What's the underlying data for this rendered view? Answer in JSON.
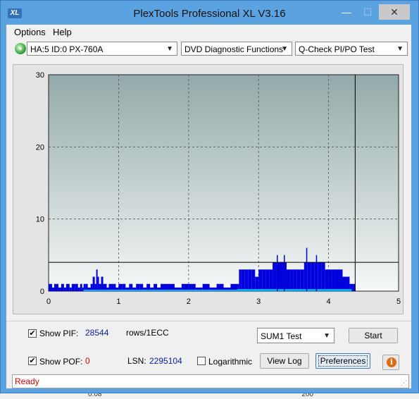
{
  "window": {
    "title": "PlexTools Professional XL V3.16",
    "app_icon_text": "XL",
    "minimize_glyph": "—",
    "maximize_glyph": "☐",
    "close_glyph": "✕"
  },
  "menu": {
    "options_label": "Options",
    "help_label": "Help"
  },
  "toolbar": {
    "drive_value": "HA:5 ID:0  PX-760A",
    "function_value": "DVD Diagnostic Functions",
    "test_value": "Q-Check PI/PO Test"
  },
  "chart_data": {
    "type": "bar",
    "xlim": [
      0,
      5
    ],
    "ylim": [
      0,
      30
    ],
    "x_ticks": [
      "0",
      "1",
      "2",
      "3",
      "4",
      "5"
    ],
    "y_ticks": [
      "0",
      "10",
      "20",
      "30"
    ],
    "threshold_line": 4,
    "end_marker_x": 4.38,
    "grid": true,
    "series": [
      {
        "color": "#0000dd",
        "x": [
          0.0,
          0.03,
          0.05,
          0.08,
          0.1,
          0.14,
          0.18,
          0.22,
          0.25,
          0.3,
          0.33,
          0.38,
          0.42,
          0.45,
          0.48,
          0.5,
          0.53,
          0.56,
          0.6,
          0.63,
          0.66,
          0.68,
          0.7,
          0.72,
          0.75,
          0.78,
          0.8,
          0.83,
          0.86,
          0.9,
          0.93,
          0.96,
          1.0,
          1.05,
          1.1,
          1.15,
          1.2,
          1.25,
          1.3,
          1.35,
          1.4,
          1.45,
          1.5,
          1.55,
          1.6,
          1.7,
          1.8,
          1.9,
          2.0,
          2.1,
          2.2,
          2.3,
          2.4,
          2.5,
          2.6,
          2.7,
          2.72,
          2.75,
          2.8,
          2.85,
          2.9,
          2.95,
          3.0,
          3.05,
          3.1,
          3.15,
          3.2,
          3.25,
          3.3,
          3.35,
          3.4,
          3.45,
          3.5,
          3.55,
          3.6,
          3.65,
          3.7,
          3.75,
          3.8,
          3.85,
          3.9,
          3.95,
          4.0,
          4.05,
          4.1,
          4.15,
          4.2,
          4.25,
          4.3,
          4.35
        ],
        "values": [
          1,
          1,
          0.5,
          1,
          1,
          0.5,
          1,
          0.5,
          1,
          0.5,
          1,
          1,
          0.5,
          1,
          0.5,
          1,
          1,
          0.5,
          1,
          2,
          1,
          3,
          2,
          1,
          2,
          1,
          1,
          0.5,
          1,
          1,
          1,
          0.5,
          1,
          1,
          0.5,
          1,
          0.5,
          1,
          1,
          0.5,
          1,
          0.5,
          1,
          0.5,
          1,
          1,
          0.5,
          1,
          1,
          0.5,
          1,
          0.5,
          1,
          0.5,
          1,
          1,
          3,
          3,
          3,
          3,
          3,
          2,
          3,
          3,
          3,
          3,
          4,
          4,
          4,
          4,
          3,
          3,
          3,
          3,
          3,
          4,
          4,
          4,
          4,
          4,
          4,
          3,
          3,
          3,
          3,
          3,
          2,
          2,
          1,
          1
        ]
      },
      {
        "color": "#00aaff",
        "x": [
          0.5,
          1.0,
          1.5,
          2.0,
          2.5,
          2.7,
          2.9,
          3.1,
          3.3,
          3.5,
          3.7,
          3.9,
          4.1,
          4.3
        ],
        "values": [
          0.2,
          0.2,
          0.2,
          0.2,
          0.2,
          0.3,
          0.3,
          0.3,
          0.3,
          0.3,
          0.3,
          0.3,
          0.3,
          0.3
        ]
      }
    ],
    "spikes": [
      {
        "x": 3.26,
        "value": 5
      },
      {
        "x": 3.68,
        "value": 6
      },
      {
        "x": 3.82,
        "value": 5
      },
      {
        "x": 3.36,
        "value": 5
      }
    ]
  },
  "controls": {
    "show_pif_label": "Show PIF:",
    "pif_value": "28544",
    "rows_label": "rows/1ECC",
    "show_pof_label": "Show POF:",
    "pof_value": "0",
    "lsn_label": "LSN:",
    "lsn_value": "2295104",
    "logarithmic_label": "Logarithmic",
    "sum_test_value": "SUM1 Test",
    "start_label": "Start",
    "view_log_label": "View Log",
    "preferences_label": "Preferences",
    "info_glyph": "i",
    "check_glyph": "✔"
  },
  "status": {
    "text": "Ready"
  },
  "desktop": {
    "bottom_number": "200",
    "bottom_number_left": "0.08"
  }
}
